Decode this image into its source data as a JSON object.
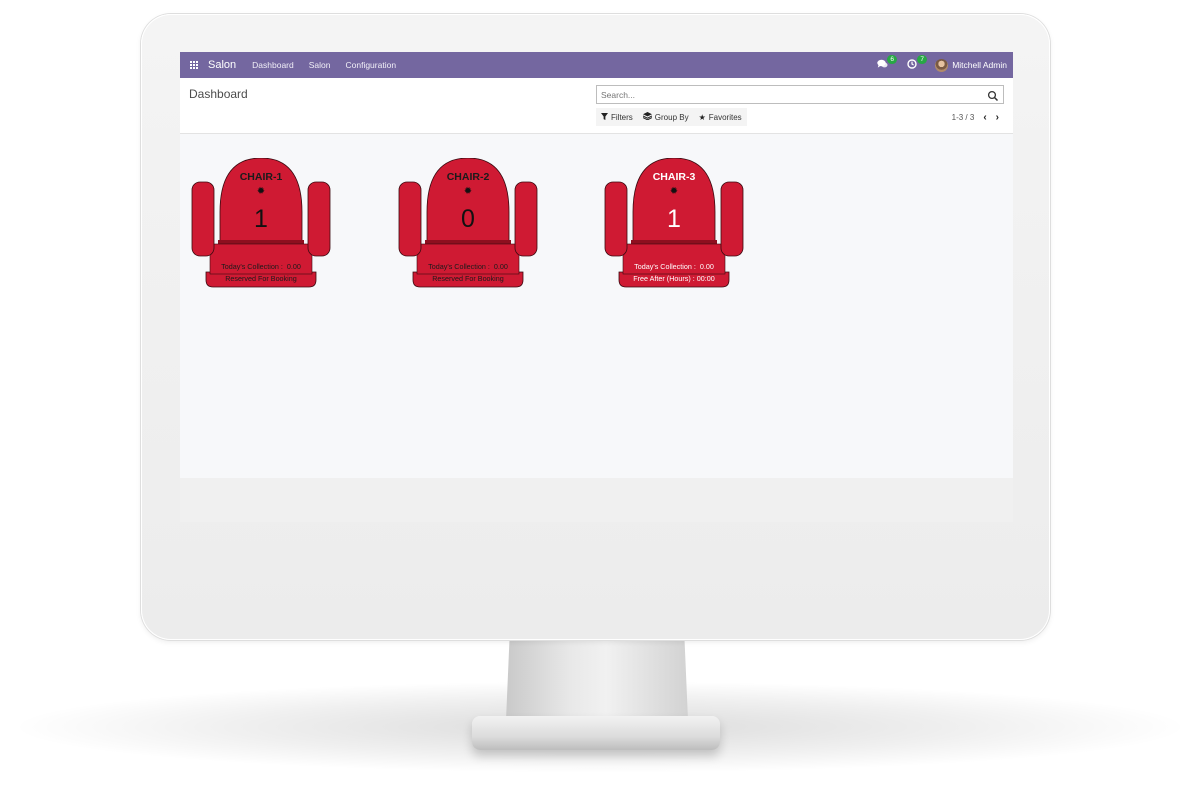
{
  "navbar": {
    "brand": "Salon",
    "menu": [
      "Dashboard",
      "Salon",
      "Configuration"
    ],
    "messages_badge": "6",
    "activities_badge": "7",
    "user_name": "Mitchell Admin"
  },
  "control_panel": {
    "title": "Dashboard",
    "search_placeholder": "Search...",
    "filters_label": "Filters",
    "group_by_label": "Group By",
    "favorites_label": "Favorites",
    "pager": "1-3 / 3"
  },
  "chairs": [
    {
      "name": "CHAIR-1",
      "count": "1",
      "collection_label": "Today's Collection :",
      "collection_value": "0.00",
      "status": "Reserved For Booking",
      "color": "#cf1a33",
      "text_color": "dark"
    },
    {
      "name": "CHAIR-2",
      "count": "0",
      "collection_label": "Today's Collection :",
      "collection_value": "0.00",
      "status": "Reserved For Booking",
      "color": "#cf1a33",
      "text_color": "dark"
    },
    {
      "name": "CHAIR-3",
      "count": "1",
      "collection_label": "Today's Collection :",
      "collection_value": "0.00",
      "status": "Free After (Hours) :  00:00",
      "color": "#cf1a33",
      "text_color": "light"
    }
  ],
  "colors": {
    "navbar": "#7467a0",
    "chair_red": "#cf1a33",
    "chair_dark": "#8e0f1f",
    "badge_green": "#28a745"
  }
}
